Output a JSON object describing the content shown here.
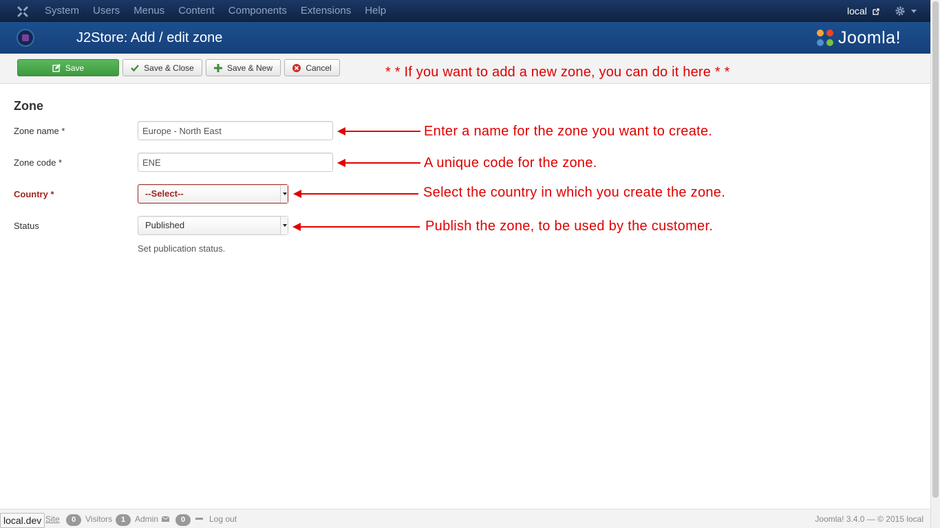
{
  "navbar": {
    "menu": [
      "System",
      "Users",
      "Menus",
      "Content",
      "Components",
      "Extensions",
      "Help"
    ],
    "user": "local"
  },
  "header": {
    "title": "J2Store: Add / edit zone",
    "brand": "Joomla!"
  },
  "toolbar": {
    "save_label": "Save",
    "save_close_label": "Save & Close",
    "save_new_label": "Save & New",
    "cancel_label": "Cancel",
    "note": "* * If you want to add a new zone, you can do it here * *"
  },
  "form": {
    "section_title": "Zone",
    "zone_name": {
      "label": "Zone name *",
      "value": "Europe - North East"
    },
    "zone_code": {
      "label": "Zone code *",
      "value": "ENE"
    },
    "country": {
      "label": "Country *",
      "value": "--Select--"
    },
    "status": {
      "label": "Status",
      "value": "Published",
      "help": "Set publication status."
    }
  },
  "annotations": [
    "Enter a name for the zone you want to create.",
    "A unique code for the zone.",
    "Select the country in which you create the zone.",
    "Publish the zone, to be used by the customer."
  ],
  "statusbar": {
    "url": "local.dev",
    "site_label": "Site",
    "visitors_count": "0",
    "visitors_label": "Visitors",
    "admin_count": "1",
    "admin_label": "Admin",
    "messages_count": "0",
    "logout_label": "Log out",
    "version": "Joomla! 3.4.0 — © 2015 local"
  },
  "colors": {
    "annotation": "#e00000",
    "navbar": "#142849",
    "header": "#1c4f8f",
    "save_button": "#5cb85c"
  }
}
